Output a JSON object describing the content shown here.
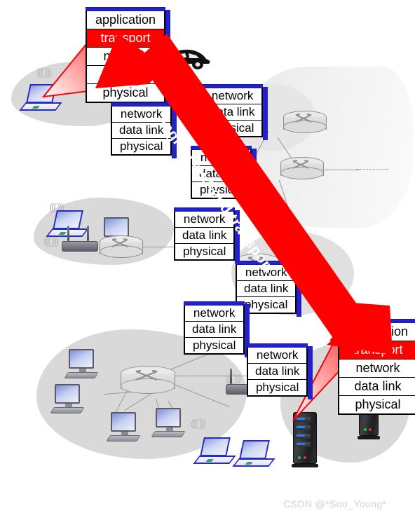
{
  "figure": {
    "title": "logical end-end transport",
    "watermark": "CSDN @*Soo_Young*",
    "colors": {
      "highlight_red": "#ff0000",
      "stack_blue": "#2222c8",
      "arrow_red": "#ff0000",
      "cloud_gray": "#d9d9d9",
      "label_text": "#000000",
      "highlight_text": "#ffffff",
      "watermark_gray": "#d2d2d2"
    }
  },
  "arrow": {
    "label": "logical end-end transport",
    "from": "top-left host application stack",
    "to": "bottom-right server application stack"
  },
  "layer_names": {
    "application": "application",
    "transport": "transport",
    "network": "network",
    "data_link": "data link",
    "physical": "physical"
  },
  "stacks": [
    {
      "id": "host-source",
      "kind": "end-system",
      "rows": [
        "application",
        "transport",
        "network",
        "data link",
        "physical"
      ],
      "highlight_row": 1
    },
    {
      "id": "router-1",
      "kind": "router",
      "rows": [
        "network",
        "data link",
        "physical"
      ],
      "highlight_row": -1
    },
    {
      "id": "router-2",
      "kind": "router",
      "rows": [
        "network",
        "data link",
        "physical"
      ],
      "highlight_row": -1
    },
    {
      "id": "router-3",
      "kind": "router",
      "rows": [
        "network",
        "data link",
        "physical"
      ],
      "highlight_row": -1
    },
    {
      "id": "router-4",
      "kind": "router",
      "rows": [
        "network",
        "data link",
        "physical"
      ],
      "highlight_row": -1
    },
    {
      "id": "router-5",
      "kind": "router",
      "rows": [
        "network",
        "data link",
        "physical"
      ],
      "highlight_row": -1
    },
    {
      "id": "router-6",
      "kind": "router",
      "rows": [
        "network",
        "data link",
        "physical"
      ],
      "highlight_row": -1
    },
    {
      "id": "router-7",
      "kind": "router",
      "rows": [
        "network",
        "data link",
        "physical"
      ],
      "highlight_row": -1
    },
    {
      "id": "host-dest",
      "kind": "end-system",
      "rows": [
        "application",
        "transport",
        "network",
        "data link",
        "physical"
      ],
      "highlight_row": 1
    }
  ],
  "devices": {
    "laptops": 5,
    "desktops": 5,
    "wireless_access_points": 3,
    "routers": 4,
    "servers": 2,
    "cars": 1
  }
}
